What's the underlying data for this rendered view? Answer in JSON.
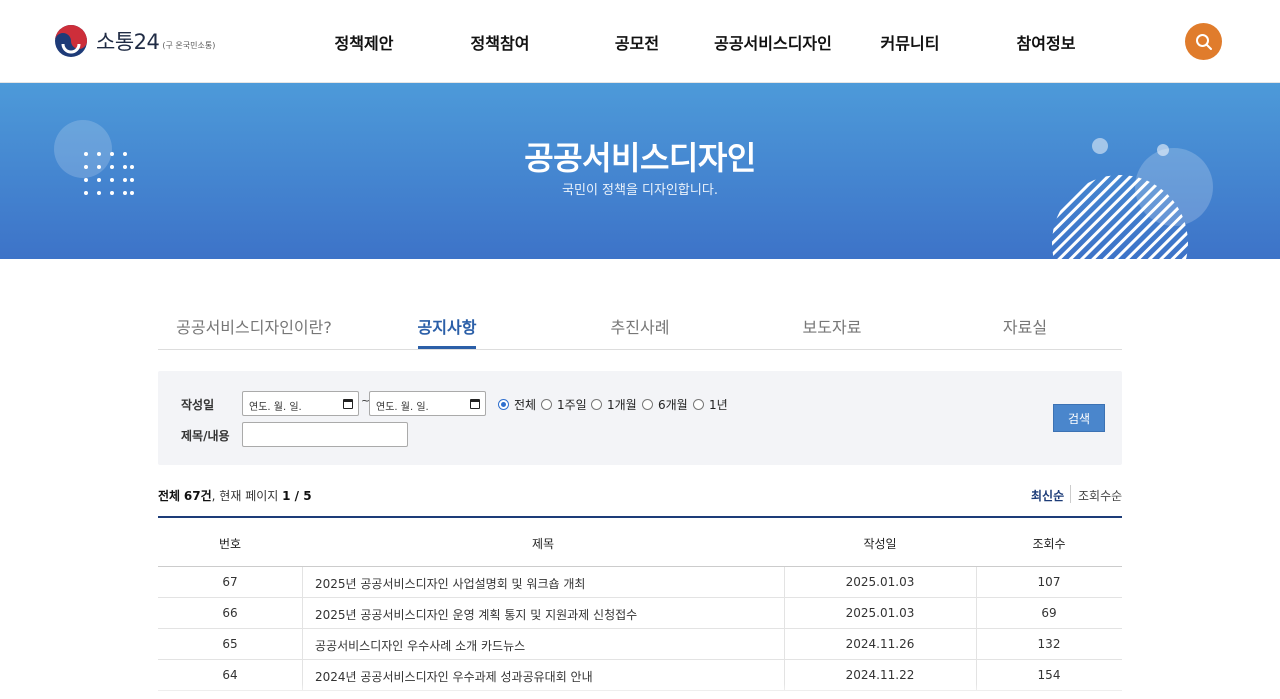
{
  "header": {
    "logo_text": "소통24",
    "logo_sub": "(구 온국민소통)",
    "nav": [
      "정책제안",
      "정책참여",
      "공모전",
      "공공서비스디자인",
      "커뮤니티",
      "참여정보"
    ],
    "search_icon": "search-icon"
  },
  "banner": {
    "title": "공공서비스디자인",
    "subtitle": "국민이 정책을 디자인합니다."
  },
  "tabs": [
    {
      "label": "공공서비스디자인이란?",
      "active": false
    },
    {
      "label": "공지사항",
      "active": true
    },
    {
      "label": "추진사례",
      "active": false
    },
    {
      "label": "보도자료",
      "active": false
    },
    {
      "label": "자료실",
      "active": false
    }
  ],
  "search": {
    "date_label": "작성일",
    "date_from_placeholder": "연도. 월. 일.",
    "date_to_placeholder": "연도. 월. 일.",
    "tilde": "~",
    "periods": [
      {
        "label": "전체",
        "checked": true
      },
      {
        "label": "1주일",
        "checked": false
      },
      {
        "label": "1개월",
        "checked": false
      },
      {
        "label": "6개월",
        "checked": false
      },
      {
        "label": "1년",
        "checked": false
      }
    ],
    "keyword_label": "제목/내용",
    "keyword_value": "",
    "button_label": "검색"
  },
  "summary": {
    "total_prefix": "전체",
    "total_count": "67건",
    "page_prefix": ", 현재 페이지",
    "page_value": "1 / 5",
    "sort_latest": "최신순",
    "sort_views": "조회수순"
  },
  "table": {
    "headers": [
      "번호",
      "제목",
      "작성일",
      "조회수"
    ],
    "rows": [
      {
        "no": "67",
        "title": "2025년 공공서비스디자인 사업설명회 및 워크숍 개최",
        "date": "2025.01.03",
        "views": "107"
      },
      {
        "no": "66",
        "title": "2025년 공공서비스디자인 운영 계획 통지 및 지원과제 신청접수",
        "date": "2025.01.03",
        "views": "69"
      },
      {
        "no": "65",
        "title": "공공서비스디자인 우수사례 소개 카드뉴스",
        "date": "2024.11.26",
        "views": "132"
      },
      {
        "no": "64",
        "title": "2024년 공공서비스디자인 우수과제 성과공유대회 안내",
        "date": "2024.11.22",
        "views": "154"
      }
    ]
  },
  "colors": {
    "accent": "#2b5fa8",
    "search_button": "#e07c2c",
    "banner_top": "#4d9ad9",
    "banner_bottom": "#3d73c8"
  }
}
